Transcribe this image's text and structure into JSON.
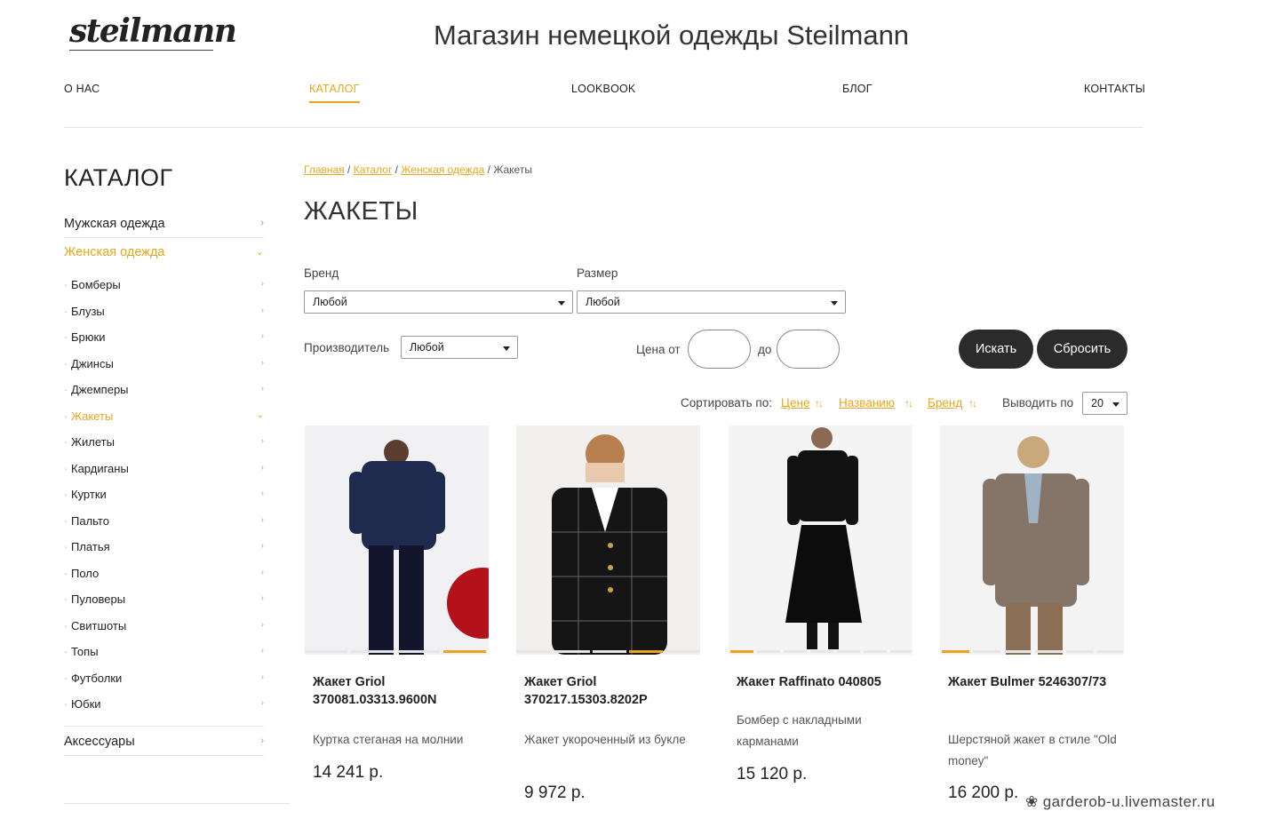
{
  "header": {
    "logo": "steilmann",
    "title": "Магазин немецкой одежды Steilmann"
  },
  "nav": [
    "О НАС",
    "КАТАЛОГ",
    "LOOKBOOK",
    "БЛОГ",
    "КОНТАКТЫ"
  ],
  "sidebar": {
    "title": "КАТАЛОГ",
    "mens": "Мужская одежда",
    "womens": "Женская одежда",
    "accessories": "Аксессуары",
    "items": [
      "Бомберы",
      "Блузы",
      "Брюки",
      "Джинсы",
      "Джемперы",
      "Жакеты",
      "Жилеты",
      "Кардиганы",
      "Куртки",
      "Пальто",
      "Платья",
      "Поло",
      "Пуловеры",
      "Свитшоты",
      "Топы",
      "Футболки",
      "Юбки"
    ]
  },
  "breadcrumb": {
    "home": "Главная",
    "catalog": "Каталог",
    "section": "Женская одежда",
    "current": "Жакеты",
    "sep": " / "
  },
  "page_title": "ЖАКЕТЫ",
  "filters": {
    "brand_label": "Бренд",
    "brand_value": "Любой",
    "size_label": "Размер",
    "size_value": "Любой",
    "maker_label": "Производитель",
    "maker_value": "Любой",
    "price_from": "Цена от",
    "price_to": "до",
    "search": "Искать",
    "reset": "Сбросить"
  },
  "sort": {
    "label": "Сортировать по:",
    "price": "Цене",
    "name": "Названию",
    "brand": "Бренд",
    "per_page_label": "Выводить по",
    "per_page_value": "20"
  },
  "products": [
    {
      "name": "Жакет Griol 370081.03313.9600N",
      "desc": "Куртка стеганая на молнии",
      "price": "14 241 р."
    },
    {
      "name": "Жакет Griol 370217.15303.8202P",
      "desc": "Жакет укороченный из букле",
      "price": "9 972 р."
    },
    {
      "name": "Жакет Raffinato 040805",
      "desc": "Бомбер с накладными карманами",
      "price": "15 120 р."
    },
    {
      "name": "Жакет Bulmer 5246307/73",
      "desc": "Шерстяной жакет в стиле \"Old money\"",
      "price": "16 200 р."
    }
  ],
  "watermark": "garderob-u.livemaster.ru",
  "colors": {
    "accent": "#e9a51e",
    "button": "#2b2b2b"
  }
}
